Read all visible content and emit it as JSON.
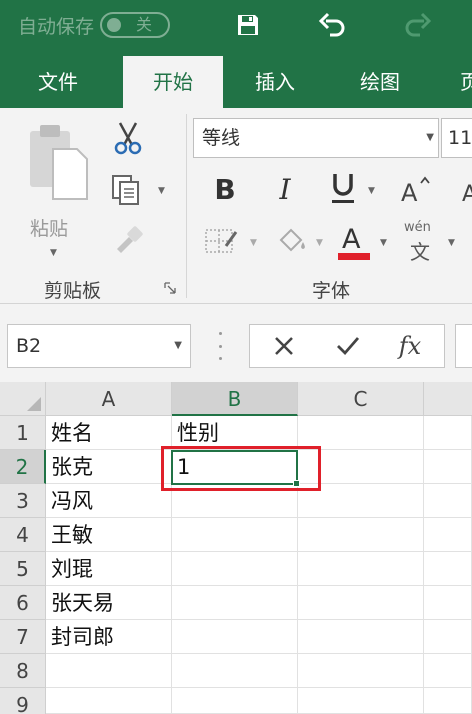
{
  "titlebar": {
    "autosave_label": "自动保存",
    "autosave_state": "关"
  },
  "tabs": [
    {
      "label": "文件",
      "active": false
    },
    {
      "label": "开始",
      "active": true
    },
    {
      "label": "插入",
      "active": false
    },
    {
      "label": "绘图",
      "active": false
    },
    {
      "label": "页",
      "active": false
    }
  ],
  "ribbon": {
    "clipboard": {
      "paste_label": "粘贴",
      "group_label": "剪贴板"
    },
    "font": {
      "font_name": "等线",
      "font_size": "11",
      "group_label": "字体",
      "phonetic_label": "wén",
      "phonetic_char": "文",
      "font_color": "#e0202a"
    }
  },
  "formula_bar": {
    "name_box": "B2",
    "fx_label": "fx"
  },
  "sheet": {
    "columns": [
      "A",
      "B",
      "C"
    ],
    "rows": [
      "1",
      "2",
      "3",
      "4",
      "5",
      "6",
      "7",
      "8",
      "9"
    ],
    "cells": {
      "A1": "姓名",
      "B1": "性别",
      "A2": "张克",
      "B2": "1",
      "A3": "冯风",
      "A4": "王敏",
      "A5": "刘琨",
      "A6": "张天易",
      "A7": "封司郎"
    },
    "active_cell": "B2"
  },
  "colors": {
    "accent": "#217346",
    "highlight_box": "#e0202a"
  }
}
